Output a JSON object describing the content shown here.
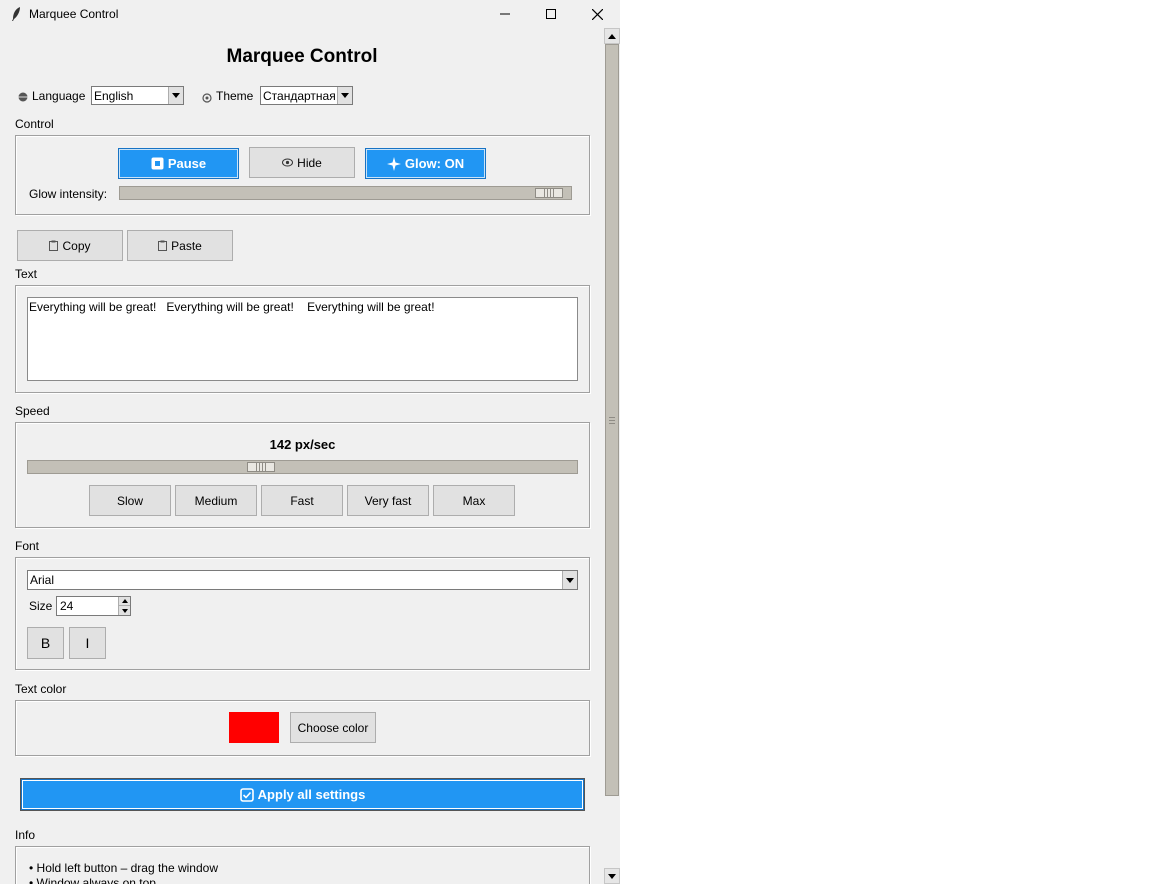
{
  "window": {
    "title": "Marquee Control"
  },
  "heading": "Marquee Control",
  "language": {
    "label": "Language",
    "value": "English"
  },
  "theme": {
    "label": "Theme",
    "value": "Стандартная"
  },
  "control": {
    "label": "Control",
    "pause_label": "Pause",
    "hide_label": "Hide",
    "glow_label": "Glow: ON",
    "glow_intensity_label": "Glow intensity:",
    "glow_intensity_fraction": 0.98
  },
  "clipboard": {
    "copy_label": "Copy",
    "paste_label": "Paste"
  },
  "text": {
    "label": "Text",
    "value": "Everything will be great!   Everything will be great!    Everything will be great!"
  },
  "speed": {
    "label": "Speed",
    "value_text": "142 px/sec",
    "slider_fraction": 0.42,
    "presets": [
      "Slow",
      "Medium",
      "Fast",
      "Very fast",
      "Max"
    ]
  },
  "font": {
    "label": "Font",
    "family": "Arial",
    "size_label": "Size",
    "size_value": "24",
    "bold_label": "B",
    "italic_label": "I"
  },
  "text_color": {
    "label": "Text color",
    "swatch_color": "#ff0000",
    "choose_label": "Choose color"
  },
  "apply": {
    "label": "Apply all settings"
  },
  "info": {
    "label": "Info",
    "lines": [
      "• Hold left button – drag the window",
      "• Window always on top"
    ]
  },
  "colors": {
    "accent": "#2196f3",
    "window_bg": "#f0f0f0"
  }
}
